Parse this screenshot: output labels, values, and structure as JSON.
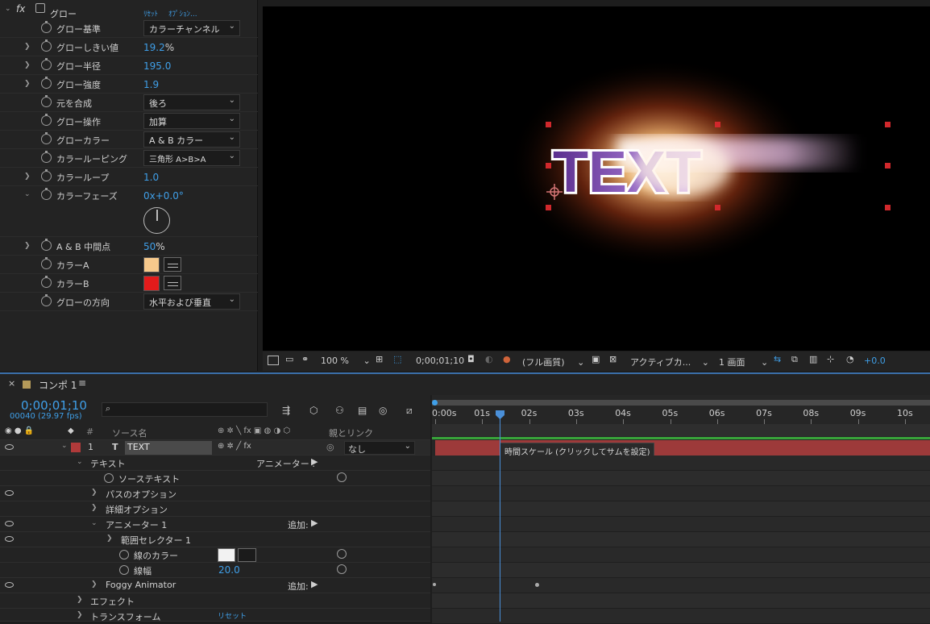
{
  "effect": {
    "fx_label": "fx",
    "name": "グロー",
    "reset": "ﾘｾｯﾄ",
    "options": "ｵﾌﾟｼｮﾝ...",
    "properties": [
      {
        "label": "グロー基準",
        "dropdown": "カラーチャンネル"
      },
      {
        "label": "グローしきい値",
        "value": "19.2",
        "unit": "%"
      },
      {
        "label": "グロー半径",
        "value": "195.0"
      },
      {
        "label": "グロー強度",
        "value": "1.9"
      },
      {
        "label": "元を合成",
        "dropdown": "後ろ"
      },
      {
        "label": "グロー操作",
        "dropdown": "加算"
      },
      {
        "label": "グローカラー",
        "dropdown": "A & B カラー"
      },
      {
        "label": "カラールーピング",
        "dropdown": "三角形 A>B>A"
      },
      {
        "label": "カラーループ",
        "value": "1.0"
      },
      {
        "label": "カラーフェーズ",
        "value": "0x+0.0°"
      },
      {
        "label": "A & B 中間点",
        "value": "50",
        "unit": "%"
      },
      {
        "label": "カラーA",
        "color": "#f6c98c"
      },
      {
        "label": "カラーB",
        "color": "#e31b1b"
      },
      {
        "label": "グローの方向",
        "dropdown": "水平および垂直"
      }
    ]
  },
  "viewer": {
    "text": "TEXT",
    "zoom": "100 %",
    "timecode": "0;00;01;10",
    "quality": "(フル画質)",
    "camera": "アクティブカ...",
    "views": "1 画面",
    "exposure": "+0.0"
  },
  "timeline": {
    "comp_name": "コンポ 1",
    "timecode": "0;00;01;10",
    "frames": "00040 (29.97 fps)",
    "col_number": "#",
    "col_source": "ソース名",
    "col_parent": "親とリンク",
    "ruler": [
      "0:00s",
      "01s",
      "02s",
      "03s",
      "04s",
      "05s",
      "06s",
      "07s",
      "08s",
      "09s",
      "10s"
    ],
    "tooltip": "時間スケール (クリックしてサムを設定)",
    "layer": {
      "number": "1",
      "type": "T",
      "name": "TEXT",
      "parent": "なし"
    },
    "rows": {
      "text": "テキスト",
      "animator_label": "アニメーター :",
      "source_text": "ソーステキスト",
      "path_options": "パスのオプション",
      "more_options": "詳細オプション",
      "animator1": "アニメーター 1",
      "add": "追加:",
      "range_selector": "範囲セレクター 1",
      "stroke_color": "線のカラー",
      "stroke_width": "線幅",
      "stroke_width_value": "20.0",
      "foggy": "Foggy Animator",
      "effects": "エフェクト",
      "transform": "トランスフォーム",
      "transform_reset": "リセット"
    }
  },
  "colors": {
    "accent_blue": "#3f9fe8",
    "layer_bar": "#9d3a3a",
    "playhead": "#4a8fd8"
  }
}
